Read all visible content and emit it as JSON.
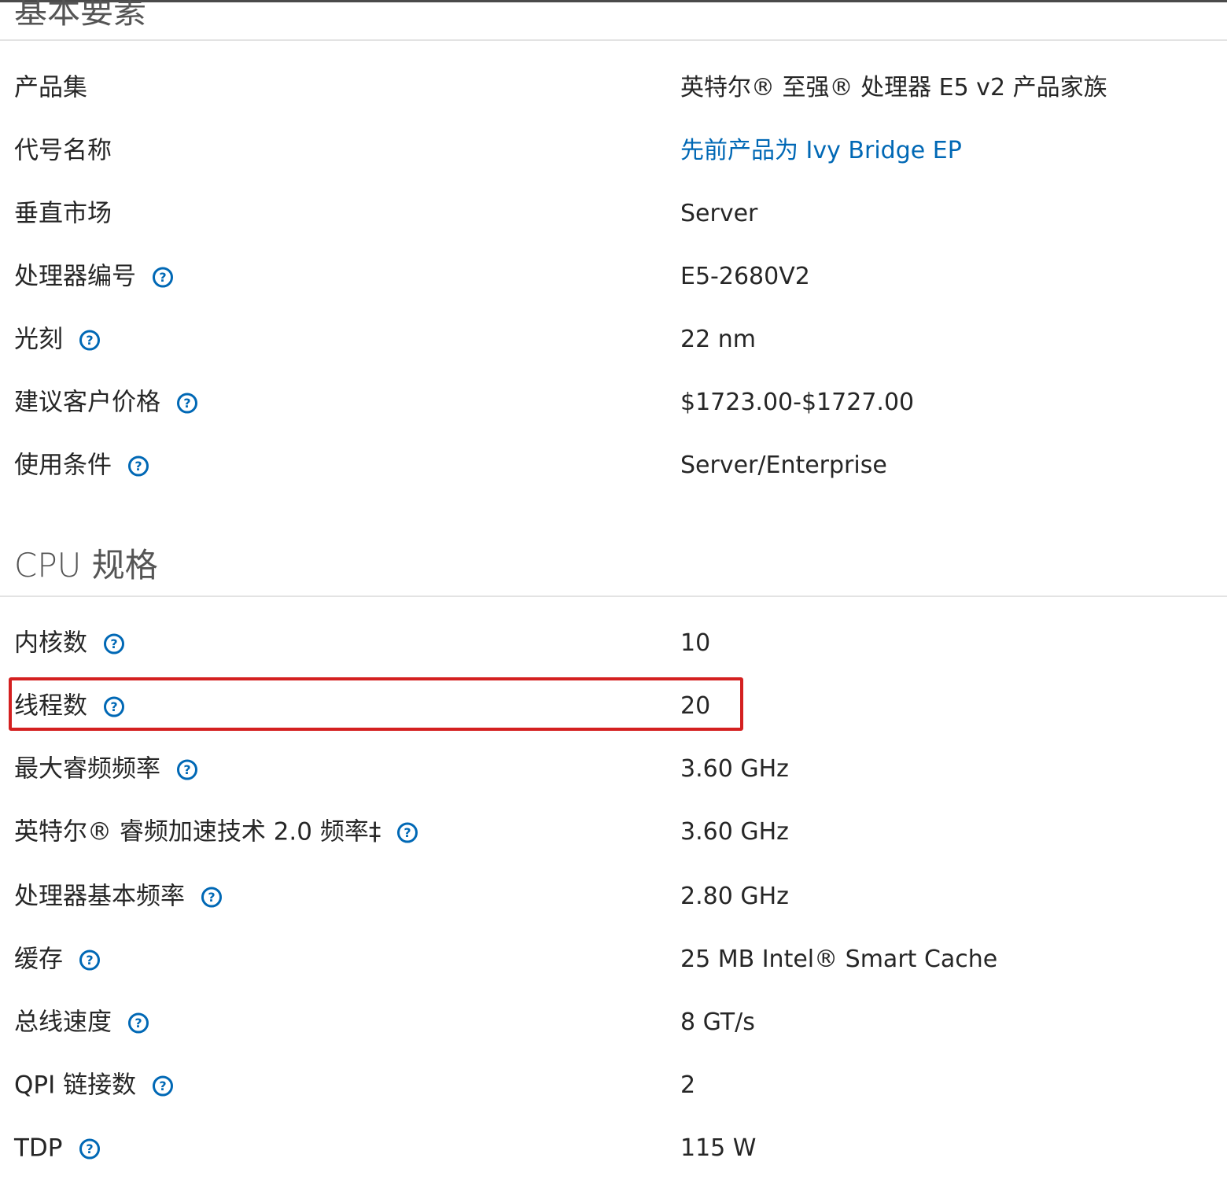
{
  "sections": {
    "basic": {
      "title": "基本要素",
      "rows": [
        {
          "label": "产品集",
          "value": "英特尔® 至强® 处理器 E5 v2 产品家族",
          "help": false
        },
        {
          "label": "代号名称",
          "value": "先前产品为 Ivy Bridge EP",
          "help": false,
          "link": true
        },
        {
          "label": "垂直市场",
          "value": "Server",
          "help": false
        },
        {
          "label": "处理器编号",
          "value": "E5-2680V2",
          "help": true
        },
        {
          "label": "光刻",
          "value": "22 nm",
          "help": true
        },
        {
          "label": "建议客户价格",
          "value": "$1723.00-$1727.00",
          "help": true
        },
        {
          "label": "使用条件",
          "value": "Server/Enterprise",
          "help": true
        }
      ]
    },
    "cpu": {
      "title": "CPU 规格",
      "rows": [
        {
          "label": "内核数",
          "value": "10",
          "help": true
        },
        {
          "label": "线程数",
          "value": "20",
          "help": true,
          "highlighted": true
        },
        {
          "label": "最大睿频频率",
          "value": "3.60 GHz",
          "help": true
        },
        {
          "label": "英特尔® 睿频加速技术 2.0 频率‡",
          "value": "3.60 GHz",
          "help": true
        },
        {
          "label": "处理器基本频率",
          "value": "2.80 GHz",
          "help": true
        },
        {
          "label": "缓存",
          "value": "25 MB Intel® Smart Cache",
          "help": true
        },
        {
          "label": "总线速度",
          "value": "8 GT/s",
          "help": true
        },
        {
          "label": "QPI 链接数",
          "value": "2",
          "help": true
        },
        {
          "label": "TDP",
          "value": "115 W",
          "help": true
        }
      ]
    }
  },
  "colors": {
    "link": "#0068b5",
    "highlight_border": "#d42020",
    "help_icon": "#0068b5"
  },
  "icons": {
    "help": "question-circle-icon"
  }
}
